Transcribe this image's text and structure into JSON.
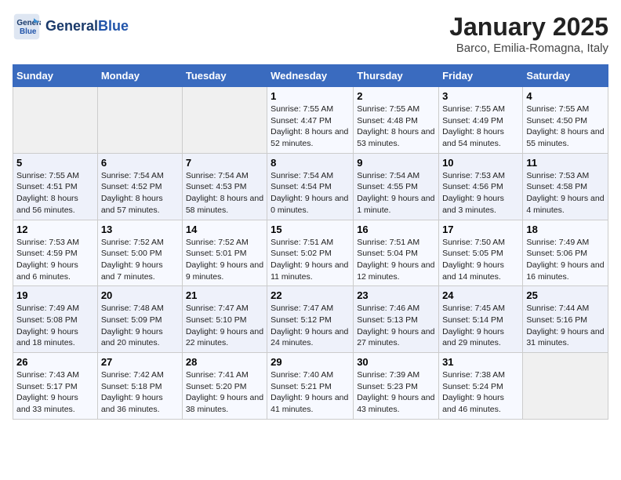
{
  "header": {
    "logo_line1": "General",
    "logo_line2": "Blue",
    "month": "January 2025",
    "location": "Barco, Emilia-Romagna, Italy"
  },
  "days_of_week": [
    "Sunday",
    "Monday",
    "Tuesday",
    "Wednesday",
    "Thursday",
    "Friday",
    "Saturday"
  ],
  "weeks": [
    [
      {
        "num": "",
        "info": ""
      },
      {
        "num": "",
        "info": ""
      },
      {
        "num": "",
        "info": ""
      },
      {
        "num": "1",
        "info": "Sunrise: 7:55 AM\nSunset: 4:47 PM\nDaylight: 8 hours and 52 minutes."
      },
      {
        "num": "2",
        "info": "Sunrise: 7:55 AM\nSunset: 4:48 PM\nDaylight: 8 hours and 53 minutes."
      },
      {
        "num": "3",
        "info": "Sunrise: 7:55 AM\nSunset: 4:49 PM\nDaylight: 8 hours and 54 minutes."
      },
      {
        "num": "4",
        "info": "Sunrise: 7:55 AM\nSunset: 4:50 PM\nDaylight: 8 hours and 55 minutes."
      }
    ],
    [
      {
        "num": "5",
        "info": "Sunrise: 7:55 AM\nSunset: 4:51 PM\nDaylight: 8 hours and 56 minutes."
      },
      {
        "num": "6",
        "info": "Sunrise: 7:54 AM\nSunset: 4:52 PM\nDaylight: 8 hours and 57 minutes."
      },
      {
        "num": "7",
        "info": "Sunrise: 7:54 AM\nSunset: 4:53 PM\nDaylight: 8 hours and 58 minutes."
      },
      {
        "num": "8",
        "info": "Sunrise: 7:54 AM\nSunset: 4:54 PM\nDaylight: 9 hours and 0 minutes."
      },
      {
        "num": "9",
        "info": "Sunrise: 7:54 AM\nSunset: 4:55 PM\nDaylight: 9 hours and 1 minute."
      },
      {
        "num": "10",
        "info": "Sunrise: 7:53 AM\nSunset: 4:56 PM\nDaylight: 9 hours and 3 minutes."
      },
      {
        "num": "11",
        "info": "Sunrise: 7:53 AM\nSunset: 4:58 PM\nDaylight: 9 hours and 4 minutes."
      }
    ],
    [
      {
        "num": "12",
        "info": "Sunrise: 7:53 AM\nSunset: 4:59 PM\nDaylight: 9 hours and 6 minutes."
      },
      {
        "num": "13",
        "info": "Sunrise: 7:52 AM\nSunset: 5:00 PM\nDaylight: 9 hours and 7 minutes."
      },
      {
        "num": "14",
        "info": "Sunrise: 7:52 AM\nSunset: 5:01 PM\nDaylight: 9 hours and 9 minutes."
      },
      {
        "num": "15",
        "info": "Sunrise: 7:51 AM\nSunset: 5:02 PM\nDaylight: 9 hours and 11 minutes."
      },
      {
        "num": "16",
        "info": "Sunrise: 7:51 AM\nSunset: 5:04 PM\nDaylight: 9 hours and 12 minutes."
      },
      {
        "num": "17",
        "info": "Sunrise: 7:50 AM\nSunset: 5:05 PM\nDaylight: 9 hours and 14 minutes."
      },
      {
        "num": "18",
        "info": "Sunrise: 7:49 AM\nSunset: 5:06 PM\nDaylight: 9 hours and 16 minutes."
      }
    ],
    [
      {
        "num": "19",
        "info": "Sunrise: 7:49 AM\nSunset: 5:08 PM\nDaylight: 9 hours and 18 minutes."
      },
      {
        "num": "20",
        "info": "Sunrise: 7:48 AM\nSunset: 5:09 PM\nDaylight: 9 hours and 20 minutes."
      },
      {
        "num": "21",
        "info": "Sunrise: 7:47 AM\nSunset: 5:10 PM\nDaylight: 9 hours and 22 minutes."
      },
      {
        "num": "22",
        "info": "Sunrise: 7:47 AM\nSunset: 5:12 PM\nDaylight: 9 hours and 24 minutes."
      },
      {
        "num": "23",
        "info": "Sunrise: 7:46 AM\nSunset: 5:13 PM\nDaylight: 9 hours and 27 minutes."
      },
      {
        "num": "24",
        "info": "Sunrise: 7:45 AM\nSunset: 5:14 PM\nDaylight: 9 hours and 29 minutes."
      },
      {
        "num": "25",
        "info": "Sunrise: 7:44 AM\nSunset: 5:16 PM\nDaylight: 9 hours and 31 minutes."
      }
    ],
    [
      {
        "num": "26",
        "info": "Sunrise: 7:43 AM\nSunset: 5:17 PM\nDaylight: 9 hours and 33 minutes."
      },
      {
        "num": "27",
        "info": "Sunrise: 7:42 AM\nSunset: 5:18 PM\nDaylight: 9 hours and 36 minutes."
      },
      {
        "num": "28",
        "info": "Sunrise: 7:41 AM\nSunset: 5:20 PM\nDaylight: 9 hours and 38 minutes."
      },
      {
        "num": "29",
        "info": "Sunrise: 7:40 AM\nSunset: 5:21 PM\nDaylight: 9 hours and 41 minutes."
      },
      {
        "num": "30",
        "info": "Sunrise: 7:39 AM\nSunset: 5:23 PM\nDaylight: 9 hours and 43 minutes."
      },
      {
        "num": "31",
        "info": "Sunrise: 7:38 AM\nSunset: 5:24 PM\nDaylight: 9 hours and 46 minutes."
      },
      {
        "num": "",
        "info": ""
      }
    ]
  ]
}
